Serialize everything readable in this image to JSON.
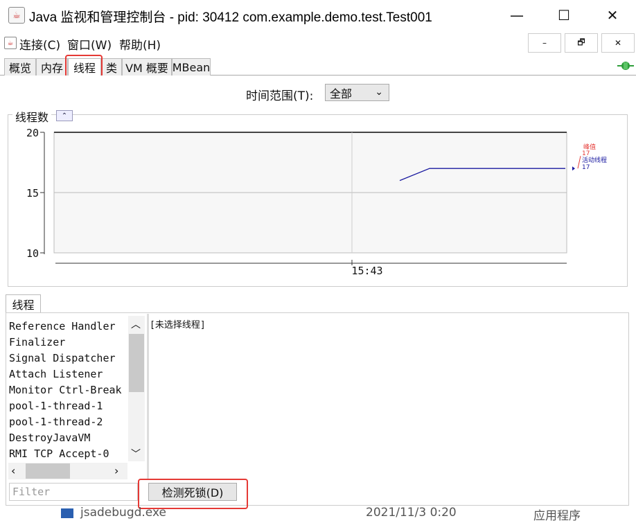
{
  "window": {
    "title": "Java 监视和管理控制台 - pid: 30412 com.example.demo.test.Test001",
    "controls": {
      "minimize": "—",
      "maximize": "☐",
      "close": "✕"
    },
    "mdi_controls": {
      "minimize": "–",
      "restore": "🗗",
      "close": "✕"
    }
  },
  "menubar": {
    "items": [
      {
        "label": "连接(C)"
      },
      {
        "label": "窗口(W)"
      },
      {
        "label": "帮助(H)"
      }
    ]
  },
  "tabs": [
    {
      "label": "概览",
      "selected": false
    },
    {
      "label": "内存",
      "selected": false
    },
    {
      "label": "线程",
      "selected": true
    },
    {
      "label": "类",
      "selected": false
    },
    {
      "label": "VM 概要",
      "selected": false
    },
    {
      "label": "MBean",
      "selected": false
    }
  ],
  "time_range": {
    "label": "时间范围(T):",
    "value": "全部"
  },
  "chart_section": {
    "title": "线程数",
    "collapse_icon": "double-chevron-up-icon"
  },
  "chart_data": {
    "type": "line",
    "title": "",
    "ylim": [
      10,
      20
    ],
    "yticks": [
      "20",
      "15",
      "10"
    ],
    "xticks": [
      "15:43"
    ],
    "series": [
      {
        "name": "峰值",
        "color": "#e53935",
        "x": [
          "15:43"
        ],
        "values": [
          17
        ]
      },
      {
        "name": "活动线程",
        "color": "#1a1aa0",
        "x": [
          "15:43"
        ],
        "values": [
          17
        ]
      }
    ],
    "line_values": [
      16,
      17,
      17,
      17
    ],
    "legend": {
      "peak_label": "峰值",
      "peak_value": "17",
      "live_label": "活动线程",
      "live_value": "17"
    },
    "grid": true
  },
  "threads_panel": {
    "tab_label": "线程",
    "threads": [
      "Reference Handler",
      "Finalizer",
      "Signal Dispatcher",
      "Attach Listener",
      "Monitor Ctrl-Break",
      "pool-1-thread-1",
      "pool-1-thread-2",
      "DestroyJavaVM",
      "RMI TCP Accept-0"
    ],
    "detail": "[未选择线程]",
    "filter_placeholder": "Filter",
    "deadlock_button": "检测死锁(D)"
  },
  "background_taskbar": {
    "name": "jsadebugd.exe",
    "date": "2021/11/3 0:20",
    "type": "应用程序"
  },
  "colors": {
    "highlight": "#e53935",
    "peak": "#e53935",
    "live": "#1a1aa0",
    "status_icon": "#2e9e3a"
  }
}
